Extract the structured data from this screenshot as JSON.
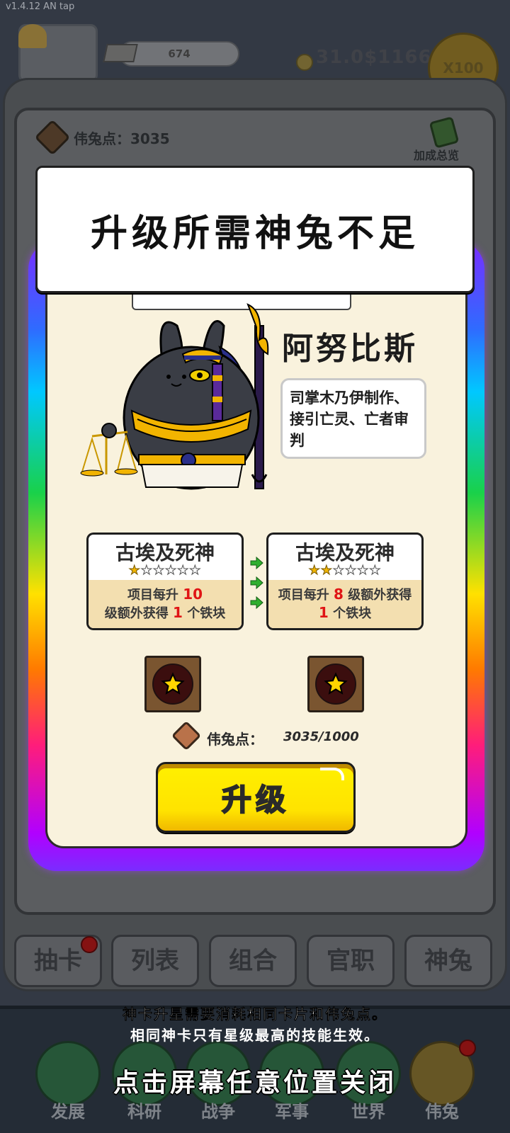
{
  "system": {
    "version": "v1.4.12 AN tap"
  },
  "hud": {
    "gold_amount": "674",
    "money": "31.0$1166",
    "multiplier_button": "X100"
  },
  "panel": {
    "points_label": "伟兔点：3035",
    "bonus_label": "加成总览"
  },
  "toast": {
    "message": "升级所需神兔不足"
  },
  "card": {
    "name": "阿努比斯",
    "description": "司掌木乃伊制作、接引亡灵、亡者审判",
    "frame_colors": [
      "#7a2cff",
      "#2f6bff",
      "#00c8ff",
      "#19d14a",
      "#ffe100",
      "#ff7a00",
      "#ff1d7a"
    ],
    "skill_current": {
      "title": "古埃及死神",
      "stars_filled": 1,
      "stars_total": 6,
      "desc_prefix": "项目每升",
      "desc_num1": "10",
      "desc_mid": "级额外获得",
      "desc_num2": "1",
      "desc_suffix": "个铁块"
    },
    "skill_next": {
      "title": "古埃及死神",
      "stars_filled": 2,
      "stars_total": 6,
      "desc_prefix": "项目每升",
      "desc_num1": "8",
      "desc_mid": "级额外获得",
      "desc_num2": "1",
      "desc_suffix": "个铁块"
    },
    "cost_label": "伟兔点：",
    "cost_value": "3035/1000",
    "upgrade_button": "升级"
  },
  "tabs": [
    {
      "label": "抽卡"
    },
    {
      "label": "列表"
    },
    {
      "label": "组合"
    },
    {
      "label": "官职"
    },
    {
      "label": "神兔"
    }
  ],
  "nav": [
    {
      "label": "发展"
    },
    {
      "label": "科研"
    },
    {
      "label": "战争"
    },
    {
      "label": "军事"
    },
    {
      "label": "世界"
    },
    {
      "label": "伟兔"
    }
  ],
  "hints": {
    "line1": "神卡升星需要消耗相同卡片和伟兔点。",
    "line2": "相同神卡只有星级最高的技能生效。",
    "close": "点击屏幕任意位置关闭"
  },
  "icons": [
    "hat-icon",
    "gold-bar-icon",
    "coin-icon",
    "points-gem-icon",
    "bonus-notebook-icon",
    "star-icon",
    "green-arrow-icon",
    "nav-dev-icon",
    "nav-research-icon",
    "nav-war-icon",
    "nav-military-icon",
    "nav-world-icon",
    "nav-rabbit-icon"
  ]
}
